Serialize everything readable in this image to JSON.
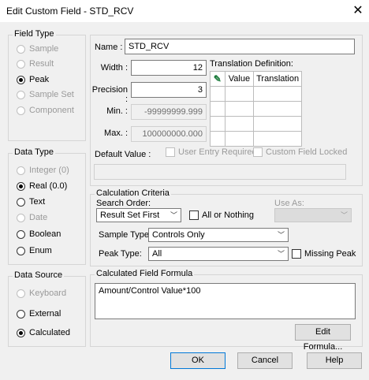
{
  "window": {
    "title": "Edit Custom Field - STD_RCV",
    "close": "✕"
  },
  "field_type": {
    "title": "Field Type",
    "options": [
      {
        "label": "Sample",
        "enabled": false,
        "selected": false
      },
      {
        "label": "Result",
        "enabled": false,
        "selected": false
      },
      {
        "label": "Peak",
        "enabled": true,
        "selected": true
      },
      {
        "label": "Sample Set",
        "enabled": false,
        "selected": false
      },
      {
        "label": "Component",
        "enabled": false,
        "selected": false
      }
    ]
  },
  "data_type": {
    "title": "Data Type",
    "options": [
      {
        "label": "Integer (0)",
        "enabled": false,
        "selected": false
      },
      {
        "label": "Real (0.0)",
        "enabled": true,
        "selected": true
      },
      {
        "label": "Text",
        "enabled": true,
        "selected": false
      },
      {
        "label": "Date",
        "enabled": false,
        "selected": false
      },
      {
        "label": "Boolean",
        "enabled": true,
        "selected": false
      },
      {
        "label": "Enum",
        "enabled": true,
        "selected": false
      }
    ]
  },
  "data_source": {
    "title": "Data Source",
    "options": [
      {
        "label": "Keyboard",
        "enabled": false,
        "selected": false
      },
      {
        "label": "External",
        "enabled": true,
        "selected": false
      },
      {
        "label": "Calculated",
        "enabled": true,
        "selected": true
      }
    ]
  },
  "name": {
    "label": "Name :",
    "value": "STD_RCV"
  },
  "width": {
    "label": "Width :",
    "value": "12"
  },
  "precision": {
    "label": "Precision :",
    "value": "3"
  },
  "min": {
    "label": "Min. :",
    "value": "-99999999.999"
  },
  "max": {
    "label": "Max. :",
    "value": "100000000.000"
  },
  "translation": {
    "label": "Translation Definition:",
    "col_value": "Value",
    "col_translation": "Translation"
  },
  "default_value": {
    "label": "Default Value :",
    "value": ""
  },
  "user_entry_required": {
    "label": "User Entry Required",
    "checked": false
  },
  "custom_field_locked": {
    "label": "Custom Field Locked",
    "checked": false
  },
  "calc": {
    "title": "Calculation Criteria",
    "search_order_label": "Search Order:",
    "search_order_value": "Result Set First",
    "all_or_nothing": "All or Nothing",
    "use_as_label": "Use As:",
    "use_as_value": "",
    "sample_type_label": "Sample Type:",
    "sample_type_value": "Controls Only",
    "peak_type_label": "Peak Type:",
    "peak_type_value": "All",
    "missing_peak": "Missing Peak"
  },
  "formula": {
    "title": "Calculated Field Formula",
    "value": "Amount/Control Value*100",
    "edit_button": "Edit Formula..."
  },
  "buttons": {
    "ok": "OK",
    "cancel": "Cancel",
    "help": "Help"
  }
}
